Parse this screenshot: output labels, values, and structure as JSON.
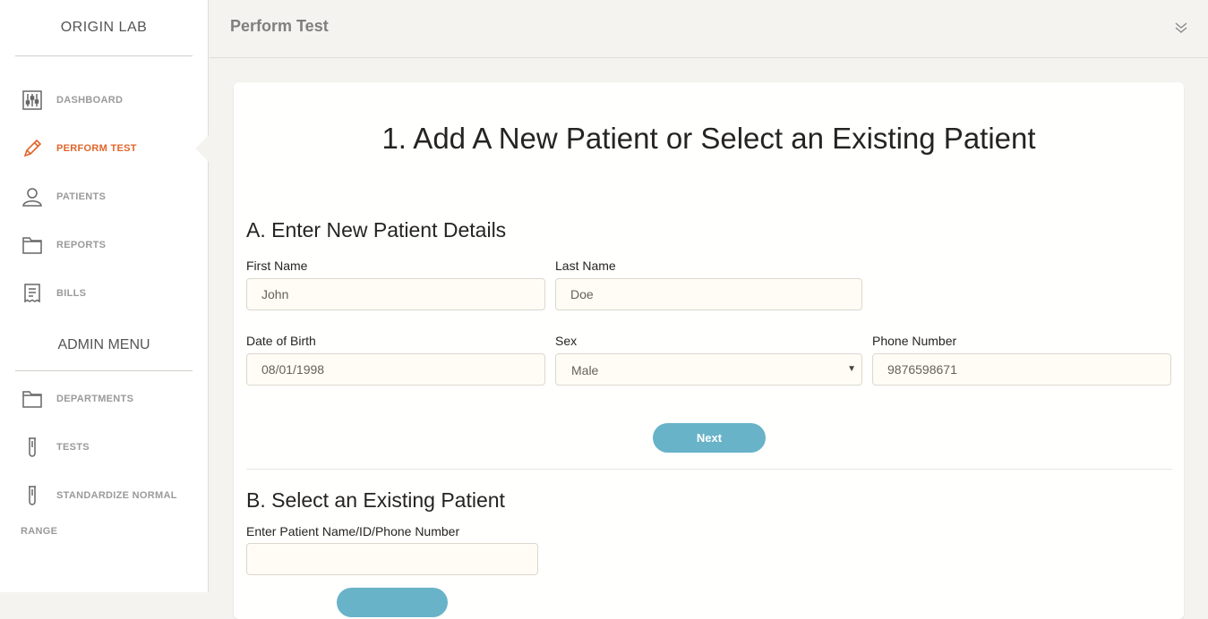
{
  "sidebar": {
    "brand": "ORIGIN LAB",
    "items": [
      {
        "label": "DASHBOARD",
        "icon": "sliders-icon"
      },
      {
        "label": "PERFORM TEST",
        "icon": "pencil-icon",
        "active": true
      },
      {
        "label": "PATIENTS",
        "icon": "user-icon"
      },
      {
        "label": "REPORTS",
        "icon": "folder-icon"
      },
      {
        "label": "BILLS",
        "icon": "receipt-icon"
      }
    ],
    "admin_heading": "ADMIN MENU",
    "admin_items": [
      {
        "label": "DEPARTMENTS",
        "icon": "folder-icon"
      },
      {
        "label": "TESTS",
        "icon": "test-tube-icon"
      },
      {
        "label": "STANDARDIZE NORMAL",
        "label_cont": "RANGE",
        "icon": "test-tube-icon"
      }
    ],
    "active_color": "#e0652b"
  },
  "header": {
    "title": "Perform Test"
  },
  "main": {
    "title": "1. Add A New Patient or Select an Existing Patient",
    "section_a": {
      "title": "A. Enter New Patient Details",
      "first_name": {
        "label": "First Name",
        "value": "John"
      },
      "last_name": {
        "label": "Last Name",
        "value": "Doe"
      },
      "dob": {
        "label": "Date of Birth",
        "value": "08/01/1998"
      },
      "sex": {
        "label": "Sex",
        "value": "Male"
      },
      "phone": {
        "label": "Phone Number",
        "value": "9876598671"
      },
      "next_label": "Next"
    },
    "section_b": {
      "title": "B. Select an Existing Patient",
      "search": {
        "label": "Enter Patient Name/ID/Phone Number",
        "value": ""
      }
    }
  },
  "colors": {
    "accent": "#68b3c8",
    "input_bg": "#fffcf5",
    "page_bg": "#f4f3ef"
  }
}
